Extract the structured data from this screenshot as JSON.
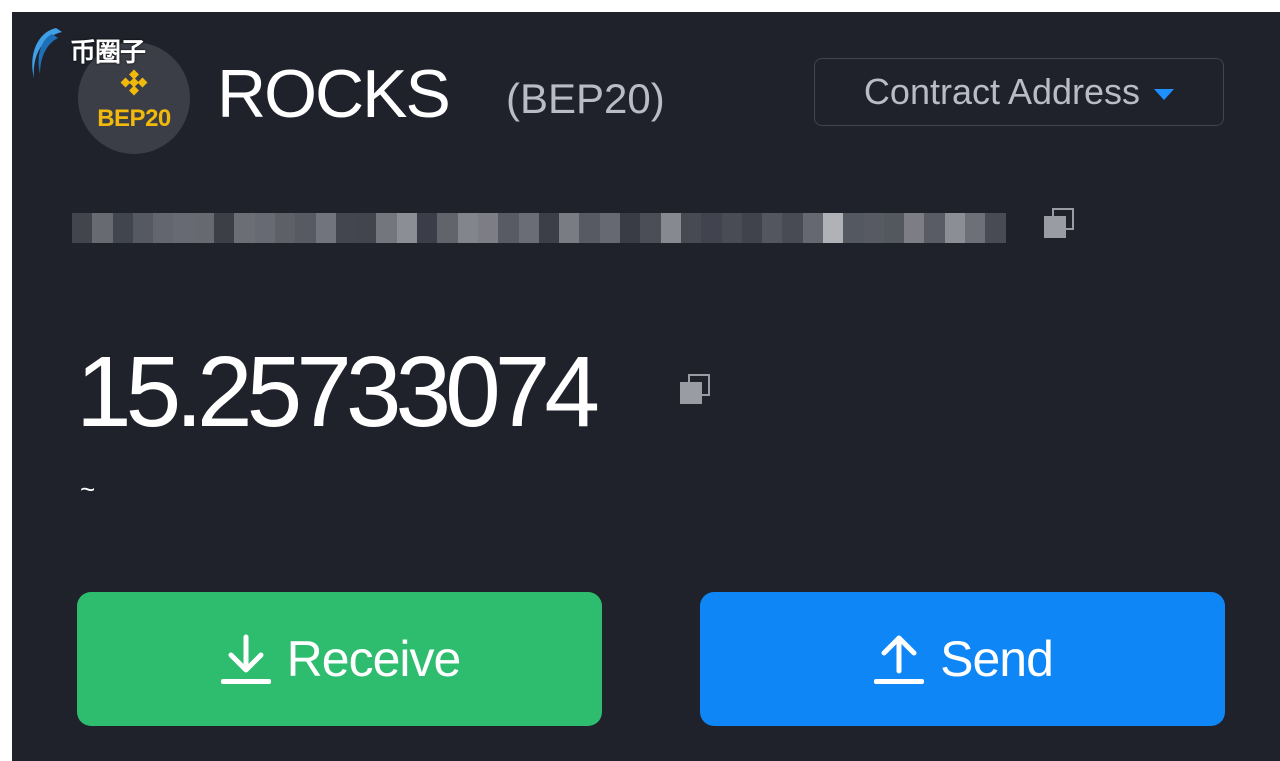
{
  "watermark": {
    "text": "币圈子"
  },
  "token": {
    "badge_label": "BEP20",
    "name": "ROCKS",
    "standard": "(BEP20)"
  },
  "contract_dropdown": {
    "label": "Contract Address"
  },
  "balance": {
    "amount": "15.25733074",
    "fiat_value": "~"
  },
  "actions": {
    "receive_label": "Receive",
    "send_label": "Send"
  },
  "icons": {
    "badge": "bnb-chain-icon",
    "caret": "caret-down-icon",
    "copy": "copy-icon",
    "receive": "download-arrow-icon",
    "send": "upload-arrow-icon"
  },
  "colors": {
    "background": "#1f222b",
    "receive_button": "#2ebd6f",
    "send_button": "#0f86f5",
    "bnb_yellow": "#f0b90b",
    "accent_blue": "#1e90ff"
  }
}
